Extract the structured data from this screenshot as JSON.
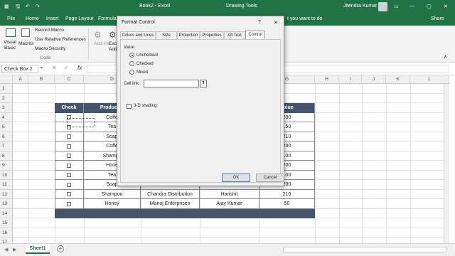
{
  "titlebar": {
    "document": "Book2 - Excel",
    "context_tab": "Drawing Tools",
    "user": "Jitendra Kumar"
  },
  "ribbon_tabs": [
    "File",
    "Home",
    "Insert",
    "Page Layout",
    "Formulas",
    "Data",
    "Review",
    "View",
    "Developer",
    "Format"
  ],
  "tell_me": "t you want to do",
  "share": "Share",
  "ribbon": {
    "visual_basic": "Visual Basic",
    "macros": "Macros",
    "record_macro": "Record Macro",
    "relative_refs": "Use Relative References",
    "macro_security": "Macro Security",
    "group_code": "Code",
    "addins": "Add-ins",
    "excel_addins": "Exc",
    "add2": "Add-"
  },
  "namebox": "Check Box 2",
  "fx": "fx",
  "columns": [
    "A",
    "B",
    "C",
    "D",
    "E",
    "F",
    "G",
    "H",
    "I",
    "J",
    "K",
    "L"
  ],
  "rows": [
    "1",
    "2",
    "3",
    "4",
    "5",
    "6",
    "7",
    "8",
    "9",
    "10",
    "11",
    "12",
    "13",
    "14",
    "15",
    "16",
    "17"
  ],
  "table": {
    "headers": [
      "Check",
      "Product N",
      "",
      "",
      "Value"
    ],
    "rows": [
      [
        "",
        "Coffe",
        "",
        "",
        "200"
      ],
      [
        "",
        "Tea",
        "",
        "",
        "150"
      ],
      [
        "",
        "Soap",
        "",
        "",
        "210"
      ],
      [
        "",
        "Coffe",
        "",
        "",
        "200"
      ],
      [
        "",
        "Shampo",
        "",
        "",
        "100"
      ],
      [
        "",
        "Hone",
        "",
        "",
        "200"
      ],
      [
        "",
        "Tea",
        "",
        "",
        "100"
      ],
      [
        "",
        "Soap",
        "",
        "",
        "200"
      ],
      [
        "",
        "Shampoo",
        "Chandra Distribution",
        "Harishit",
        "210"
      ],
      [
        "",
        "Honey",
        "Manoj Enterprises",
        "Ajay Kumar",
        "50"
      ]
    ]
  },
  "sheet_tab": "Sheet1",
  "dialog": {
    "title": "Format Control",
    "help": "?",
    "close": "✕",
    "tabs": [
      "Colors and Lines",
      "Size",
      "Protection",
      "Properties",
      "Alt Text",
      "Control"
    ],
    "value_label": "Value",
    "options": [
      "Unchecked",
      "Checked",
      "Mixed"
    ],
    "selected": "Unchecked",
    "cell_link": "Cell link:",
    "shading": "3-D shading",
    "ok": "OK",
    "cancel": "Cancel"
  },
  "colors": {
    "excel_green": "#217346",
    "table_header": "#44546a",
    "table_footer": "#44546a"
  }
}
